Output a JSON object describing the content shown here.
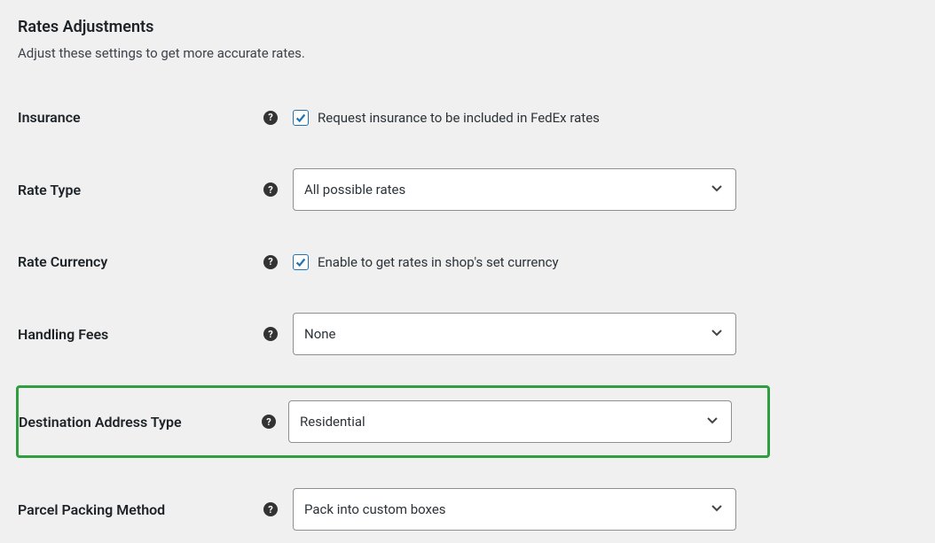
{
  "section": {
    "title": "Rates Adjustments",
    "description": "Adjust these settings to get more accurate rates."
  },
  "fields": {
    "insurance": {
      "label": "Insurance",
      "checked": true,
      "description": "Request insurance to be included in FedEx rates"
    },
    "rate_type": {
      "label": "Rate Type",
      "selected": "All possible rates"
    },
    "rate_currency": {
      "label": "Rate Currency",
      "checked": true,
      "description": "Enable to get rates in shop's set currency"
    },
    "handling_fees": {
      "label": "Handling Fees",
      "selected": "None"
    },
    "destination_address_type": {
      "label": "Destination Address Type",
      "selected": "Residential"
    },
    "parcel_packing_method": {
      "label": "Parcel Packing Method",
      "selected": "Pack into custom boxes"
    }
  }
}
